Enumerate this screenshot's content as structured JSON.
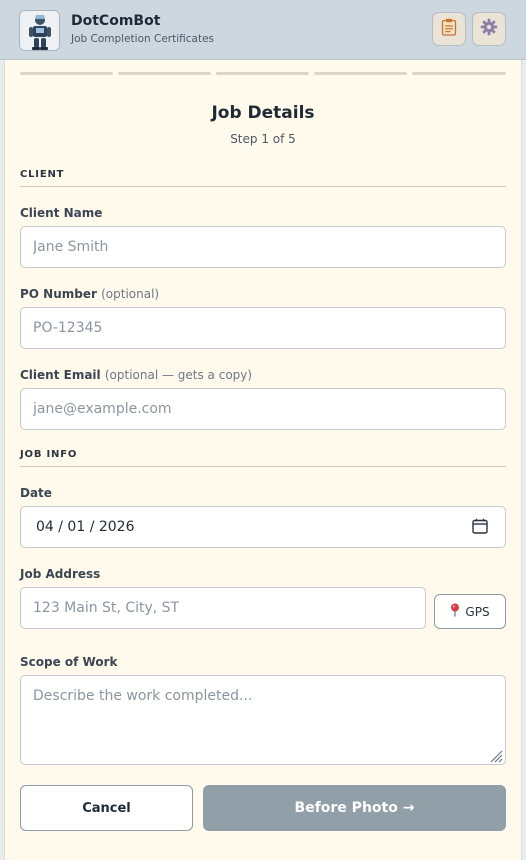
{
  "header": {
    "title": "DotComBot",
    "subtitle": "Job Completion Certificates",
    "logo_icon": "robot-icon",
    "buttons": [
      {
        "icon": "clipboard-icon"
      },
      {
        "icon": "gear-icon"
      }
    ]
  },
  "progress": {
    "total_steps": 5,
    "completed_steps": 0
  },
  "step": {
    "title": "Job Details",
    "subtitle": "Step 1 of 5"
  },
  "sections": {
    "client": "CLIENT",
    "job_info": "JOB INFO"
  },
  "fields": {
    "client_name": {
      "label": "Client Name",
      "optional": "",
      "placeholder": "Jane Smith",
      "value": ""
    },
    "po_number": {
      "label": "PO Number",
      "optional": "(optional)",
      "placeholder": "PO-12345",
      "value": ""
    },
    "client_email": {
      "label": "Client Email",
      "optional": "(optional — gets a copy)",
      "placeholder": "jane@example.com",
      "value": ""
    },
    "date": {
      "label": "Date",
      "value": "04 / 01 / 2026"
    },
    "job_address": {
      "label": "Job Address",
      "placeholder": "123 Main St, City, ST",
      "value": ""
    },
    "scope": {
      "label": "Scope of Work",
      "placeholder": "Describe the work completed...",
      "value": ""
    }
  },
  "gps_button": {
    "label": "GPS",
    "icon": "map-pin-icon"
  },
  "actions": {
    "cancel": "Cancel",
    "next": "Before Photo →"
  },
  "colors": {
    "header_bg": "#cdd7df",
    "card_bg": "#fffaec",
    "primary_disabled": "#909fa8",
    "pin_red": "#d23b4a"
  }
}
